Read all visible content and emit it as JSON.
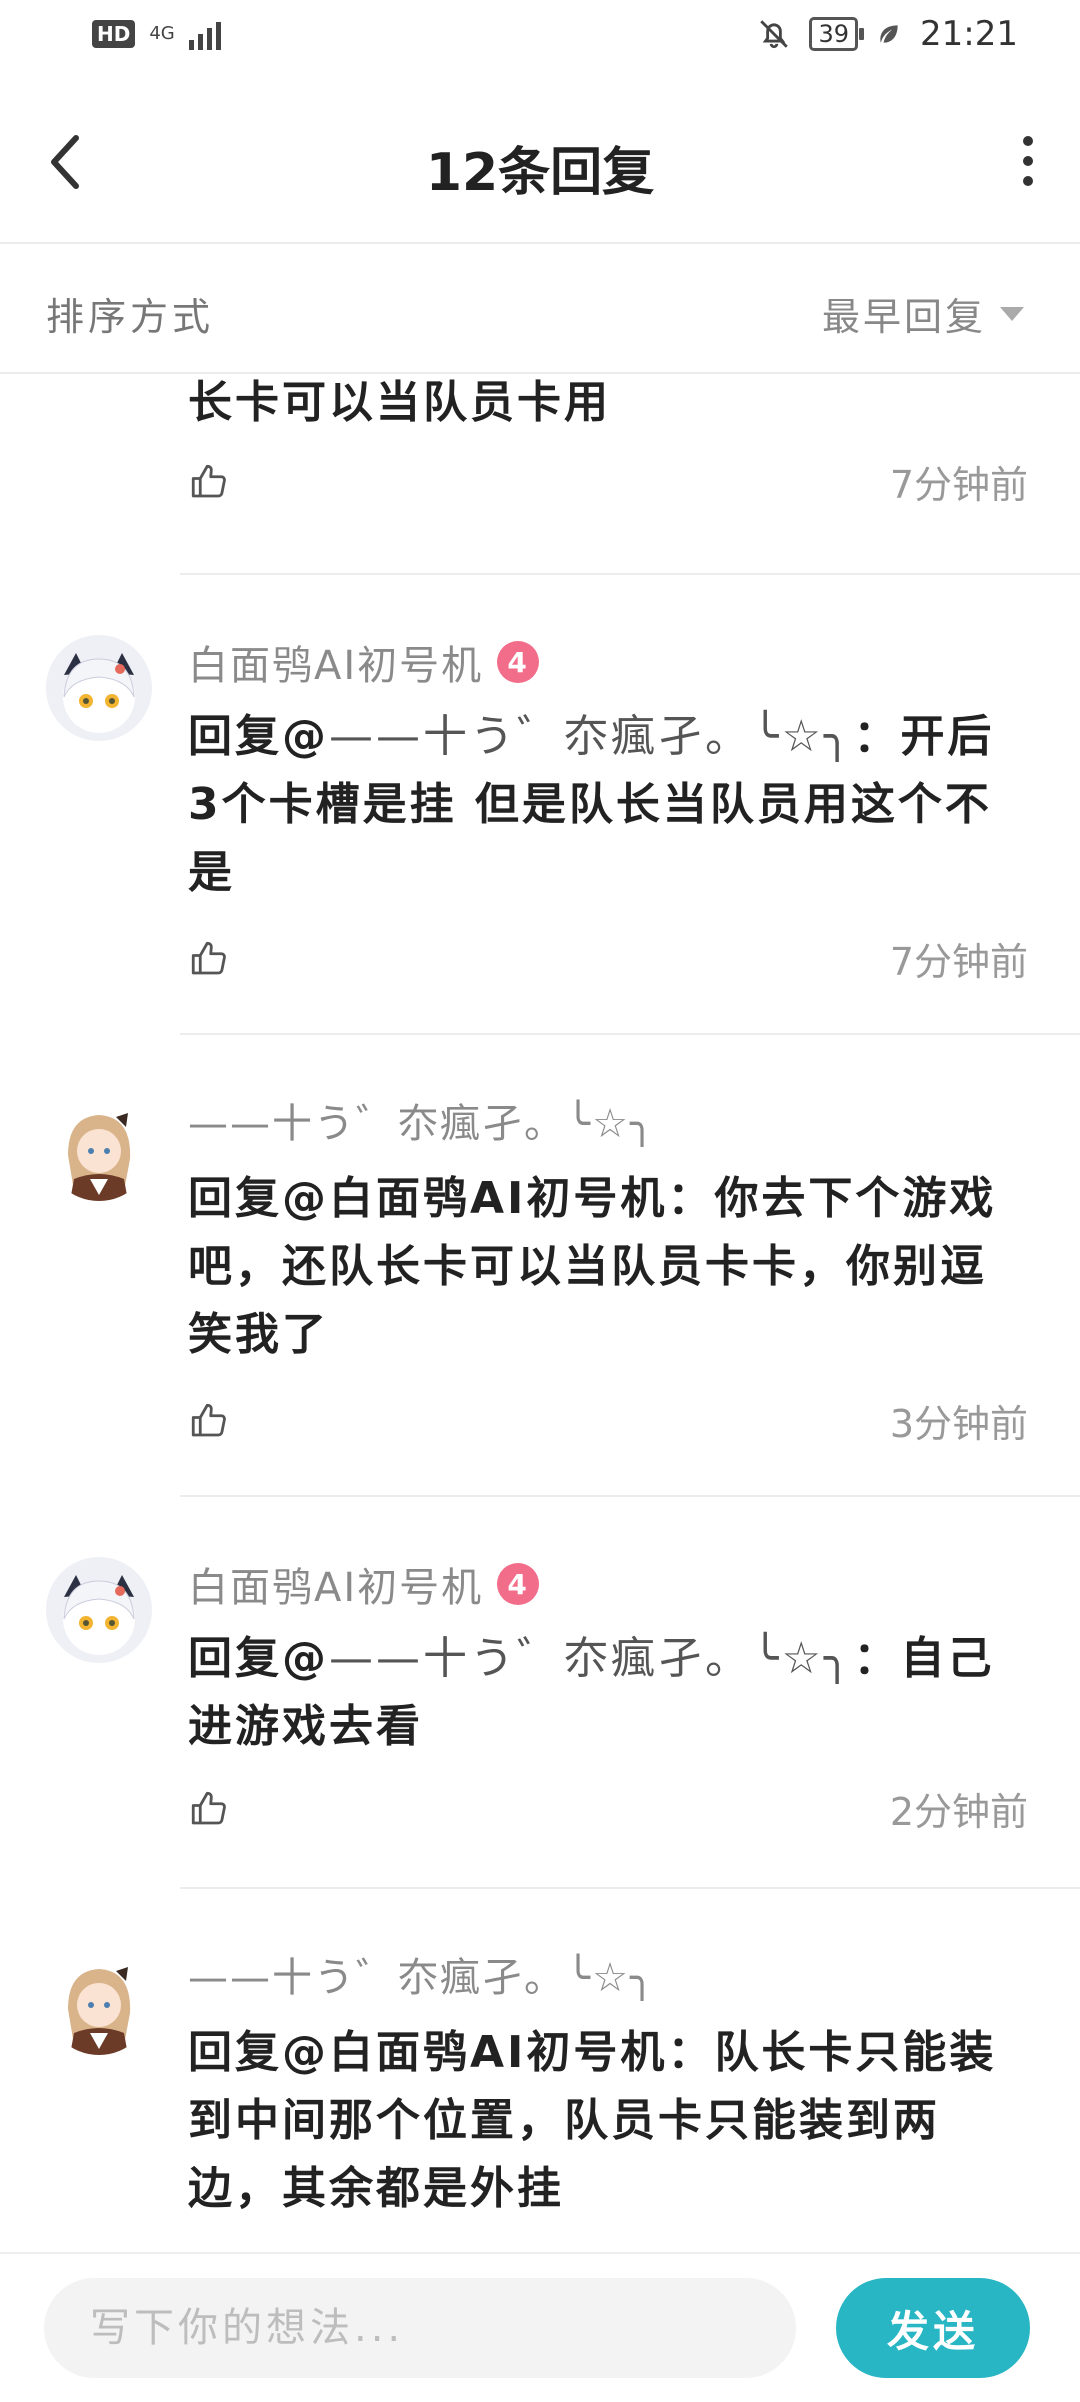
{
  "status_bar": {
    "hd": "HD",
    "network": "4G",
    "battery": "39",
    "time": "21:21"
  },
  "header": {
    "title": "12条回复"
  },
  "sort": {
    "label": "排序方式",
    "value": "最早回复"
  },
  "partial_reply": {
    "text": "长卡可以当队员卡用",
    "time": "7分钟前"
  },
  "replies": [
    {
      "user": "白面鸮AI初号机",
      "level": "4",
      "reply_prefix": "回复@",
      "reply_to": "——十う゛夵瘋孑。╰☆╮",
      "separator": "：",
      "text": "开后3个卡槽是挂 但是队长当队员用这个不是",
      "time": "7分钟前"
    },
    {
      "user": "——十う゛夵瘋孑。╰☆╮",
      "reply_prefix": "回复@",
      "reply_to": "白面鸮AI初号机",
      "separator": "：",
      "text": "你去下个游戏吧，还队长卡可以当队员卡卡，你别逗笑我了",
      "time": "3分钟前"
    },
    {
      "user": "白面鸮AI初号机",
      "level": "4",
      "reply_prefix": "回复@",
      "reply_to": "——十う゛夵瘋孑。╰☆╮",
      "separator": "：",
      "text": "自己进游戏去看",
      "time": "2分钟前"
    },
    {
      "user": "——十う゛夵瘋孑。╰☆╮",
      "reply_prefix": "回复@",
      "reply_to": "白面鸮AI初号机",
      "separator": "：",
      "text": "队长卡只能装到中间那个位置，队员卡只能装到两边，其余都是外挂",
      "time": ""
    }
  ],
  "composer": {
    "placeholder": "写下你的想法...",
    "send_label": "发送"
  },
  "colors": {
    "accent": "#28b6c4",
    "level_badge": "#f26d8a"
  }
}
